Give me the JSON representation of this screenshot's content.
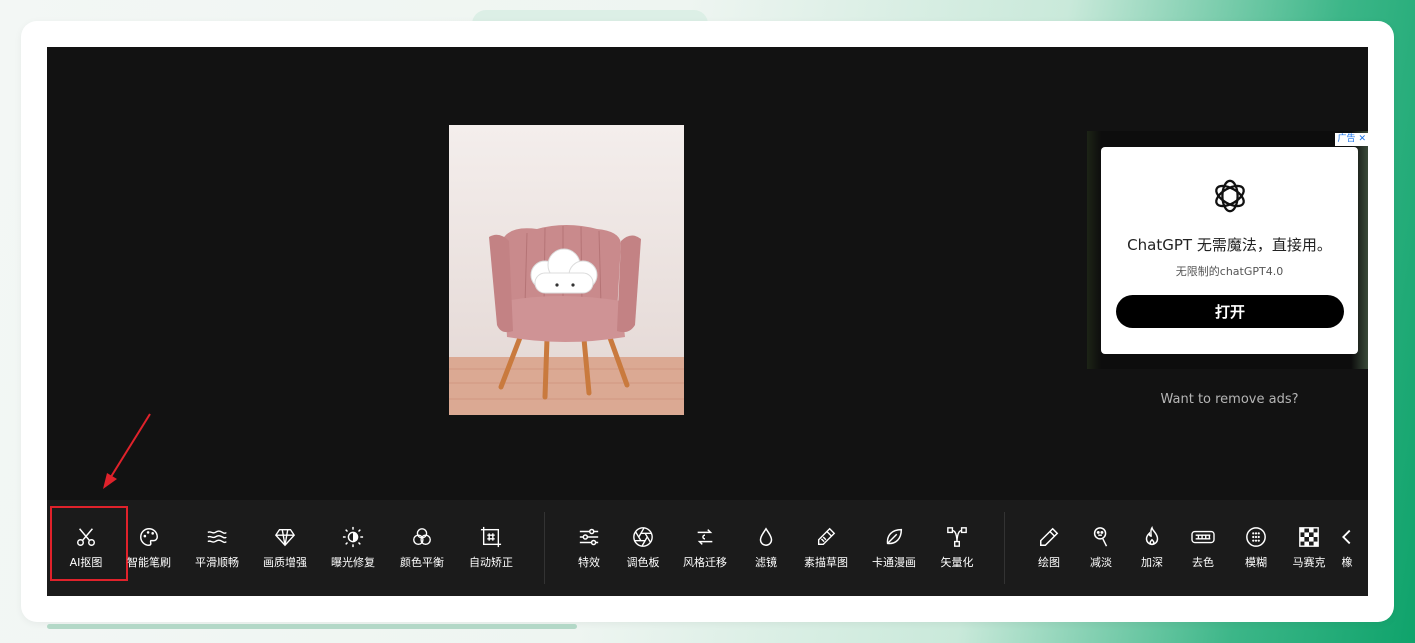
{
  "ad": {
    "badge": "广告",
    "close": "✕",
    "title": "ChatGPT 无需魔法，直接用。",
    "subtitle": "无限制的chatGPT4.0",
    "button": "打开",
    "logo": "openai-logo"
  },
  "remove_ads": "Want to remove ads?",
  "toolbar": {
    "groups": [
      [
        {
          "label": "AI抠图",
          "icon": "scissors-icon"
        },
        {
          "label": "智能笔刷",
          "icon": "palette-icon"
        },
        {
          "label": "平滑顺畅",
          "icon": "waves-icon"
        },
        {
          "label": "画质增强",
          "icon": "diamond-icon"
        },
        {
          "label": "曝光修复",
          "icon": "sun-icon"
        },
        {
          "label": "颜色平衡",
          "icon": "rgb-circles-icon"
        },
        {
          "label": "自动矫正",
          "icon": "crop-frame-icon"
        }
      ],
      [
        {
          "label": "特效",
          "icon": "sliders-icon"
        },
        {
          "label": "调色板",
          "icon": "aperture-icon"
        },
        {
          "label": "风格迁移",
          "icon": "style-transfer-icon"
        },
        {
          "label": "滤镜",
          "icon": "drop-icon"
        },
        {
          "label": "素描草图",
          "icon": "pencil-sketch-icon"
        },
        {
          "label": "卡通漫画",
          "icon": "leaf-icon"
        },
        {
          "label": "矢量化",
          "icon": "vector-icon"
        }
      ],
      [
        {
          "label": "绘图",
          "icon": "pen-icon"
        },
        {
          "label": "减淡",
          "icon": "dodge-icon"
        },
        {
          "label": "加深",
          "icon": "flame-icon"
        },
        {
          "label": "去色",
          "icon": "desaturate-icon"
        },
        {
          "label": "模糊",
          "icon": "blur-icon"
        },
        {
          "label": "马赛克",
          "icon": "mosaic-icon"
        },
        {
          "label": "橡",
          "icon": "chevron-left-icon"
        }
      ]
    ]
  },
  "colors": {
    "accent_green": "#0fa36b",
    "highlight_red": "#e0222b",
    "stage_bg": "#121212",
    "toolbar_bg": "#1b1b1b"
  }
}
